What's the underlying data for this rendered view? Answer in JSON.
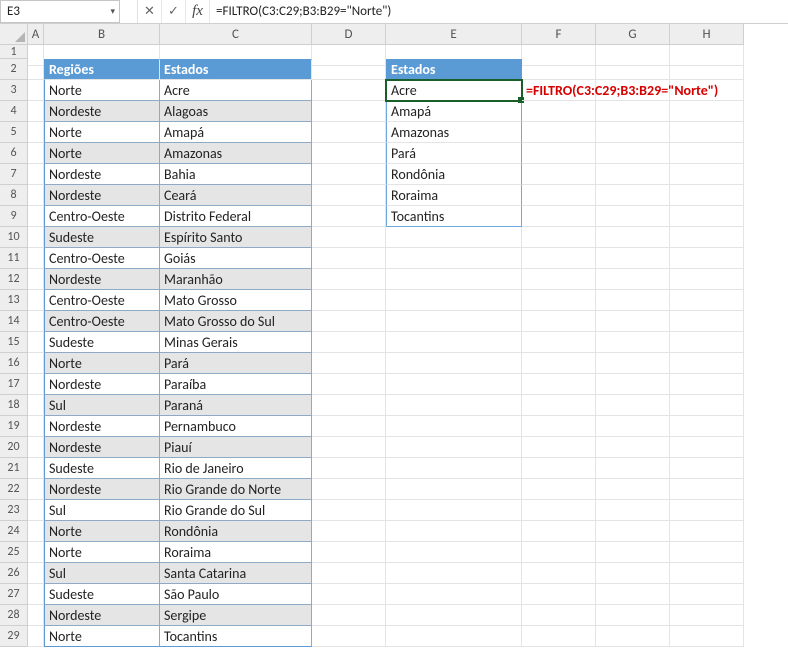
{
  "namebox": {
    "value": "E3"
  },
  "formula_bar": {
    "formula": "=FILTRO(C3:C29;B3:B29=\"Norte\")"
  },
  "columns": [
    "A",
    "B",
    "C",
    "D",
    "E",
    "F",
    "G",
    "H"
  ],
  "row_max": 29,
  "main_table": {
    "headers": {
      "regioes": "Regiões",
      "estados": "Estados"
    },
    "rows": [
      {
        "r": "Norte",
        "e": "Acre"
      },
      {
        "r": "Nordeste",
        "e": "Alagoas"
      },
      {
        "r": "Norte",
        "e": "Amapá"
      },
      {
        "r": "Norte",
        "e": "Amazonas"
      },
      {
        "r": "Nordeste",
        "e": "Bahia"
      },
      {
        "r": "Nordeste",
        "e": "Ceará"
      },
      {
        "r": "Centro-Oeste",
        "e": "Distrito Federal"
      },
      {
        "r": "Sudeste",
        "e": "Espírito Santo"
      },
      {
        "r": "Centro-Oeste",
        "e": "Goiás"
      },
      {
        "r": "Nordeste",
        "e": "Maranhão"
      },
      {
        "r": "Centro-Oeste",
        "e": "Mato Grosso"
      },
      {
        "r": "Centro-Oeste",
        "e": "Mato Grosso do Sul"
      },
      {
        "r": "Sudeste",
        "e": "Minas Gerais"
      },
      {
        "r": "Norte",
        "e": "Pará"
      },
      {
        "r": "Nordeste",
        "e": "Paraíba"
      },
      {
        "r": "Sul",
        "e": "Paraná"
      },
      {
        "r": "Nordeste",
        "e": "Pernambuco"
      },
      {
        "r": "Nordeste",
        "e": "Piauí"
      },
      {
        "r": "Sudeste",
        "e": "Rio de Janeiro"
      },
      {
        "r": "Nordeste",
        "e": "Rio Grande do Norte"
      },
      {
        "r": "Sul",
        "e": "Rio Grande do Sul"
      },
      {
        "r": "Norte",
        "e": "Rondônia"
      },
      {
        "r": "Norte",
        "e": "Roraima"
      },
      {
        "r": "Sul",
        "e": "Santa Catarina"
      },
      {
        "r": "Sudeste",
        "e": "São Paulo"
      },
      {
        "r": "Nordeste",
        "e": "Sergipe"
      },
      {
        "r": "Norte",
        "e": "Tocantins"
      }
    ]
  },
  "result_table": {
    "header": "Estados",
    "values": [
      "Acre",
      "Amapá",
      "Amazonas",
      "Pará",
      "Rondônia",
      "Roraima",
      "Tocantins"
    ]
  },
  "annotation": "=FILTRO(C3:C29;B3:B29=\"Norte\")",
  "icons": {
    "dropdown": "▾",
    "cancel": "✕",
    "confirm": "✓",
    "fx": "fx"
  }
}
